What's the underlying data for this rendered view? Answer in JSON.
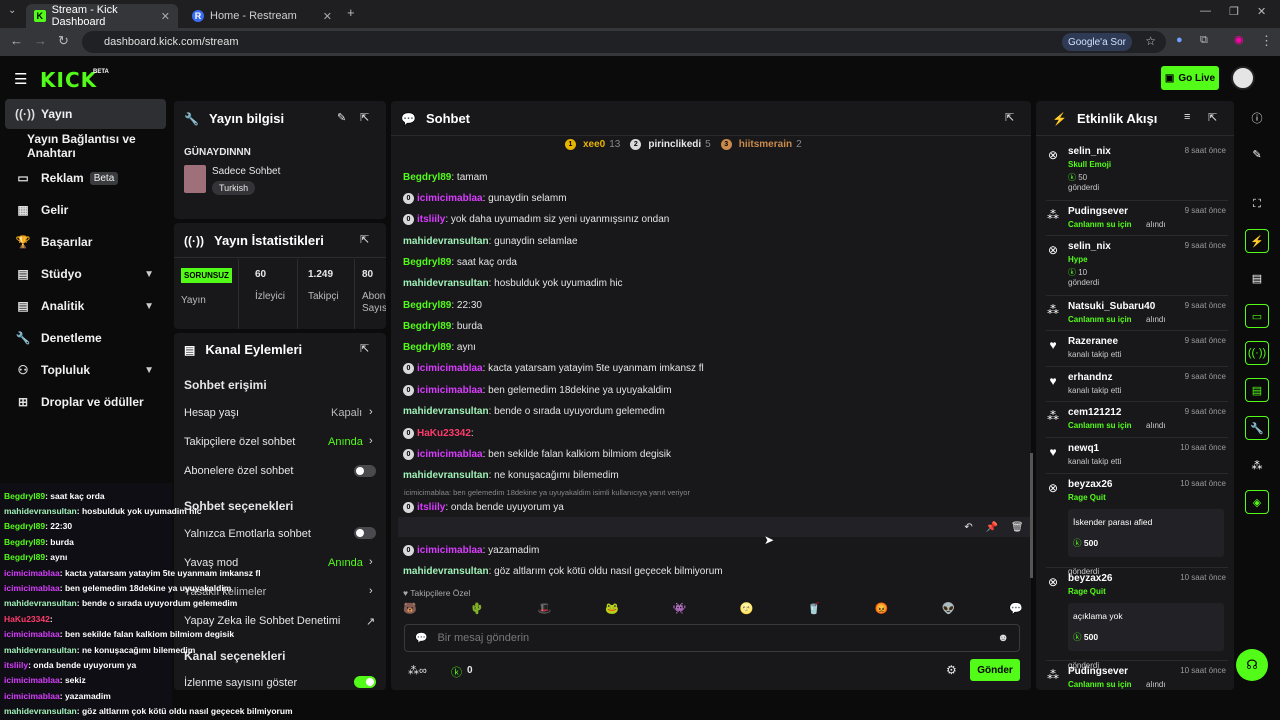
{
  "browser": {
    "tabs": [
      {
        "title": "Stream - Kick Dashboard",
        "favicon": "K"
      },
      {
        "title": "Home - Restream",
        "favicon": "R"
      }
    ],
    "url": "dashboard.kick.com/stream",
    "google_btn": "Google'a Sor"
  },
  "app": {
    "logo": "KICK",
    "beta": "BETA",
    "go_live": "Go Live"
  },
  "nav": [
    {
      "label": "Yayın",
      "icon": "broadcast-icon"
    },
    {
      "label": "Yayın Bağlantısı ve Anahtarı"
    },
    {
      "label": "Reklam",
      "badge": "Beta",
      "icon": "ad-icon"
    },
    {
      "label": "Gelir",
      "icon": "chart-icon"
    },
    {
      "label": "Başarılar",
      "icon": "trophy-icon"
    },
    {
      "label": "Stüdyo",
      "icon": "studio-icon"
    },
    {
      "label": "Analitik",
      "icon": "analytics-icon"
    },
    {
      "label": "Denetleme",
      "icon": "wrench-icon"
    },
    {
      "label": "Topluluk",
      "icon": "community-icon"
    },
    {
      "label": "Droplar ve ödüller",
      "icon": "drops-icon"
    }
  ],
  "stream_info": {
    "title": "Yayın bilgisi",
    "stream_title": "GÜNAYDINNN",
    "category": "Sadece Sohbet",
    "tag": "Turkish"
  },
  "stats": {
    "title": "Yayın İstatistikleri",
    "status": "SORUNSUZ",
    "status_label": "Yayın",
    "viewers": "60",
    "viewers_label": "İzleyici",
    "followers": "1.249",
    "followers_label": "Takipçi",
    "subs": "80",
    "subs_label": "Abon Sayıs"
  },
  "channel": {
    "title": "Kanal Eylemleri",
    "chat_access": "Sohbet erişimi",
    "account_age": "Hesap yaşı",
    "account_age_val": "Kapalı",
    "followers_only": "Takipçilere özel sohbet",
    "followers_only_val": "Anında",
    "subs_only": "Abonelere özel sohbet",
    "chat_options": "Sohbet seçenekleri",
    "emote_only": "Yalnızca Emotlarla sohbet",
    "slow_mode": "Yavaş mod",
    "slow_mode_val": "Anında",
    "banned_words": "Yasaklı kelimeler",
    "ai_mod": "Yapay Zeka ile Sohbet Denetimi",
    "channel_options": "Kanal seçenekleri",
    "show_viewers": "İzlenme sayısını göster"
  },
  "chat": {
    "title": "Sohbet",
    "leaders": [
      {
        "rank": "1",
        "name": "xee0",
        "count": "13"
      },
      {
        "rank": "2",
        "name": "pirinclikedi",
        "count": "5"
      },
      {
        "rank": "3",
        "name": "hiitsmerain",
        "count": "2"
      }
    ],
    "messages": [
      {
        "user": "Begdryl89",
        "text": ": tamam",
        "color": "green"
      },
      {
        "user": "icimicimablaa",
        "text": ": gunaydin selamm",
        "color": "pink"
      },
      {
        "user": "itsliily",
        "text": ": yok daha uyumadım siz yeni uyanmışsınız ondan",
        "color": "pink"
      },
      {
        "user": "mahidevransultan",
        "text": ": gunaydin selamlae",
        "color": "mint"
      },
      {
        "user": "Begdryl89",
        "text": ": saat kaç orda",
        "color": "green"
      },
      {
        "user": "mahidevransultan",
        "text": ": hosbulduk yok uyumadim hic",
        "color": "mint"
      },
      {
        "user": "Begdryl89",
        "text": ": 22:30",
        "color": "green"
      },
      {
        "user": "Begdryl89",
        "text": ": burda",
        "color": "green"
      },
      {
        "user": "Begdryl89",
        "text": ": aynı",
        "color": "green"
      },
      {
        "user": "icimicimablaa",
        "text": ": kacta yatarsam yatayim 5te uyanmam imkansz fl",
        "color": "pink"
      },
      {
        "user": "icimicimablaa",
        "text": ": ben gelemedim 18dekine ya uyuyakaldim",
        "color": "pink"
      },
      {
        "user": "mahidevransultan",
        "text": ": bende o sırada uyuyordum gelemedim",
        "color": "mint"
      },
      {
        "user": "HaKu23342",
        "text": ":",
        "color": "red"
      },
      {
        "user": "icimicimablaa",
        "text": ": ben sekilde falan kalkiom bilmiom degisik",
        "color": "pink"
      },
      {
        "user": "mahidevransultan",
        "text": ": ne konuşacağımı bilemedim",
        "color": "mint"
      },
      {
        "user": "itsliily",
        "text": ": onda bende uyuyorum ya",
        "color": "pink"
      },
      {
        "user": "icimicimablaa",
        "text": ": sekiz",
        "color": "pink"
      },
      {
        "user": "icimicimablaa",
        "text": ": yazamadim",
        "color": "pink"
      },
      {
        "user": "mahidevransultan",
        "text": ": göz altlarım çok kötü oldu nasıl geçecek bilmiyorum",
        "color": "mint"
      }
    ],
    "reply_note": "icimicimablaa: ben gelemedim 18dekine ya uyuyakaldim isimli kullanıcıya yanıt veriyor",
    "followers_only": "Takipçilere Özel",
    "placeholder": "Bir mesaj gönderin",
    "points": "0",
    "send": "Gönder"
  },
  "overlay": [
    {
      "u": "Begdryl89",
      "t": ": saat kaç orda",
      "c": "green"
    },
    {
      "u": "mahidevransultan",
      "t": ": hosbulduk yok uyumadim hic",
      "c": "mint"
    },
    {
      "u": "Begdryl89",
      "t": ": 22:30",
      "c": "green"
    },
    {
      "u": "Begdryl89",
      "t": ": burda",
      "c": "green"
    },
    {
      "u": "Begdryl89",
      "t": ": aynı",
      "c": "green"
    },
    {
      "u": "icimicimablaa",
      "t": ": kacta yatarsam yatayim 5te uyanmam imkansz fl",
      "c": "pink"
    },
    {
      "u": "icimicimablaa",
      "t": ": ben gelemedim 18dekine ya uyuyakaldim",
      "c": "pink"
    },
    {
      "u": "mahidevransultan",
      "t": ": bende o sırada uyuyordum gelemedim",
      "c": "mint"
    },
    {
      "u": "HaKu23342",
      "t": ":",
      "c": "red"
    },
    {
      "u": "icimicimablaa",
      "t": ": ben sekilde falan kalkiom bilmiom degisik",
      "c": "pink"
    },
    {
      "u": "mahidevransultan",
      "t": ": ne konuşacağımı bilemedim",
      "c": "mint"
    },
    {
      "u": "itsliily",
      "t": ": onda bende uyuyorum ya",
      "c": "pink"
    },
    {
      "u": "icimicimablaa",
      "t": ": sekiz",
      "c": "pink"
    },
    {
      "u": "icimicimablaa",
      "t": ": yazamadim",
      "c": "pink"
    },
    {
      "u": "mahidevransultan",
      "t": ": göz altlarım çok kötü oldu nasıl geçecek bilmiyorum",
      "c": "mint"
    }
  ],
  "activity": {
    "title": "Etkinlik Akışı",
    "events": [
      {
        "name": "selin_nix",
        "time": "8 saat önce",
        "sub": "Skull Emoji",
        "amount": "50",
        "note": "gönderdi"
      },
      {
        "name": "Pudingsever",
        "time": "9 saat önce",
        "sub": "Canlanım su için",
        "note": "alındı"
      },
      {
        "name": "selin_nix",
        "time": "9 saat önce",
        "sub": "Hype",
        "amount": "10",
        "note": "gönderdi"
      },
      {
        "name": "Natsuki_Subaru40",
        "time": "9 saat önce",
        "sub": "Canlanım su için",
        "note": "alındı"
      },
      {
        "name": "Razeranee",
        "time": "9 saat önce",
        "note": "kanalı takip etti"
      },
      {
        "name": "erhandnz",
        "time": "9 saat önce",
        "note": "kanalı takip etti"
      },
      {
        "name": "cem121212",
        "time": "9 saat önce",
        "sub": "Canlanım su için",
        "note": "alındı"
      },
      {
        "name": "newq1",
        "time": "10 saat önce",
        "note": "kanalı takip etti"
      },
      {
        "name": "beyzax26",
        "time": "10 saat önce",
        "sub": "Rage Quit",
        "msg": "İskender parası afied",
        "amount": "500",
        "note": "gönderdi"
      },
      {
        "name": "beyzax26",
        "time": "10 saat önce",
        "sub": "Rage Quit",
        "msg": "açıklama yok",
        "amount": "500",
        "note": "gönderdi"
      },
      {
        "name": "Pudingsever",
        "time": "10 saat önce",
        "sub": "Canlanım su için",
        "note": "alındı"
      }
    ]
  },
  "colors": {
    "accent": "#53fc18",
    "panel": "#18181b",
    "bg": "#0b0b0c"
  }
}
